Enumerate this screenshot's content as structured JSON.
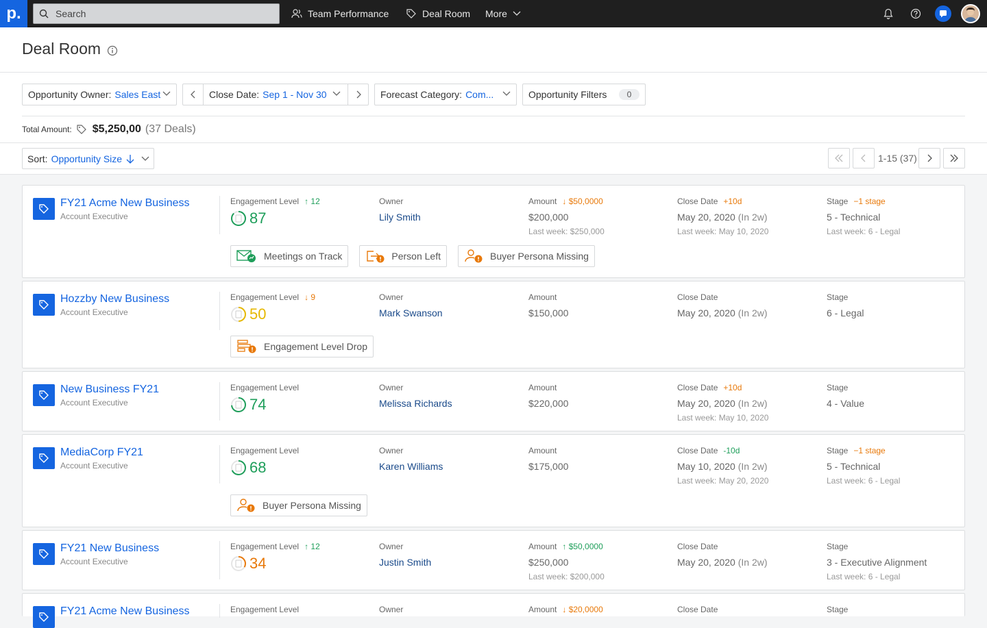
{
  "topbar": {
    "logo": "p.",
    "search_placeholder": "Search",
    "nav": [
      "Team Performance",
      "Deal Room",
      "More"
    ]
  },
  "header": {
    "title": "Deal Room"
  },
  "filters": {
    "owner_label": "Opportunity Owner:",
    "owner_value": "Sales East",
    "close_label": "Close Date:",
    "close_value": "Sep 1 - Nov 30",
    "forecast_label": "Forecast Category:",
    "forecast_value": "Com...",
    "opp_filters_label": "Opportunity Filters",
    "opp_filters_count": "0"
  },
  "total": {
    "label": "Total Amount:",
    "amount": "$5,250,00",
    "deals": "(37 Deals)"
  },
  "sort": {
    "label": "Sort:",
    "value": "Opportunity Size"
  },
  "pagination": {
    "text": "1-15 (37)"
  },
  "labels": {
    "engagement": "Engagement Level",
    "owner": "Owner",
    "amount": "Amount",
    "close": "Close Date",
    "stage": "Stage"
  },
  "colors": {
    "accent": "#1565e0",
    "green": "#1e9e5a",
    "orange": "#e8790a",
    "yellow": "#e6b800"
  },
  "deals": [
    {
      "name": "FY21 Acme New Business",
      "role": "Account Executive",
      "eng_delta": "↑ 12",
      "eng_value": "87",
      "owner": "Lily Smith",
      "amount_delta": "↓ $50,0000",
      "amount": "$200,000",
      "amount_last": "Last week: $250,000",
      "close_delta": "+10d",
      "close": "May 20, 2020",
      "close_rel": "(In 2w)",
      "close_last": "Last week: May 10, 2020",
      "stage_delta": "−1 stage",
      "stage": "5 - Technical",
      "stage_last": "Last week: 6 - Legal",
      "signals": [
        "Meetings on Track",
        "Person Left",
        "Buyer Persona Missing"
      ]
    },
    {
      "name": "Hozzby New Business",
      "role": "Account Executive",
      "eng_delta": "↓ 9",
      "eng_value": "50",
      "owner": "Mark Swanson",
      "amount": "$150,000",
      "close": "May 20, 2020",
      "close_rel": "(In 2w)",
      "stage": "6 - Legal",
      "signals": [
        "Engagement Level Drop"
      ]
    },
    {
      "name": "New Business FY21",
      "role": "Account Executive",
      "eng_value": "74",
      "owner": "Melissa Richards",
      "amount": "$220,000",
      "close_delta": "+10d",
      "close": "May 20, 2020",
      "close_rel": "(In 2w)",
      "close_last": "Last week: May 10, 2020",
      "stage": "4 - Value"
    },
    {
      "name": "MediaCorp FY21",
      "role": "Account Executive",
      "eng_value": "68",
      "owner": "Karen Williams",
      "amount": "$175,000",
      "close_delta": "-10d",
      "close": "May 10, 2020",
      "close_rel": "(In 2w)",
      "close_last": "Last week: May 20, 2020",
      "stage_delta": "−1 stage",
      "stage": "5 - Technical",
      "stage_last": "Last week: 6 - Legal",
      "signals": [
        "Buyer Persona Missing"
      ]
    },
    {
      "name": "FY21 New Business",
      "role": "Account Executive",
      "eng_delta": "↑ 12",
      "eng_value": "34",
      "owner": "Justin Smith",
      "amount_delta": "↑ $50,0000",
      "amount": "$250,000",
      "amount_last": "Last week: $200,000",
      "close": "May 20, 2020",
      "close_rel": "(In 2w)",
      "stage": "3 - Executive Alignment",
      "stage_last": "Last week: 6 - Legal"
    },
    {
      "name": "FY21 Acme New Business",
      "amount_delta": "↓ $20,0000"
    }
  ]
}
